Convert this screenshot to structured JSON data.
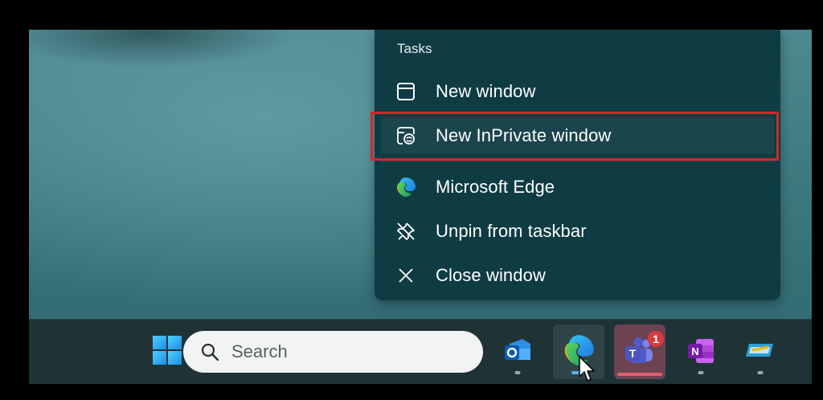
{
  "jumplist": {
    "section_header": "Tasks",
    "items": [
      {
        "label": "New window",
        "icon": "window-icon"
      },
      {
        "label": "New InPrivate window",
        "icon": "inprivate-window-icon"
      },
      {
        "label": "Microsoft Edge",
        "icon": "edge-icon"
      },
      {
        "label": "Unpin from taskbar",
        "icon": "unpin-icon"
      },
      {
        "label": "Close window",
        "icon": "close-icon"
      }
    ]
  },
  "taskbar": {
    "search_placeholder": "Search",
    "apps": [
      {
        "name": "Outlook",
        "icon": "outlook-icon"
      },
      {
        "name": "Microsoft Edge",
        "icon": "edge-icon",
        "active": true
      },
      {
        "name": "Teams",
        "icon": "teams-icon",
        "badge": "1"
      },
      {
        "name": "OneNote",
        "icon": "onenote-icon"
      },
      {
        "name": "Notepad",
        "icon": "notepad-icon"
      }
    ]
  },
  "colors": {
    "menu_bg": "#0f3c43",
    "highlight_border": "#d7262c",
    "taskbar_bg": "#1f3337",
    "badge": "#d83b3b"
  }
}
